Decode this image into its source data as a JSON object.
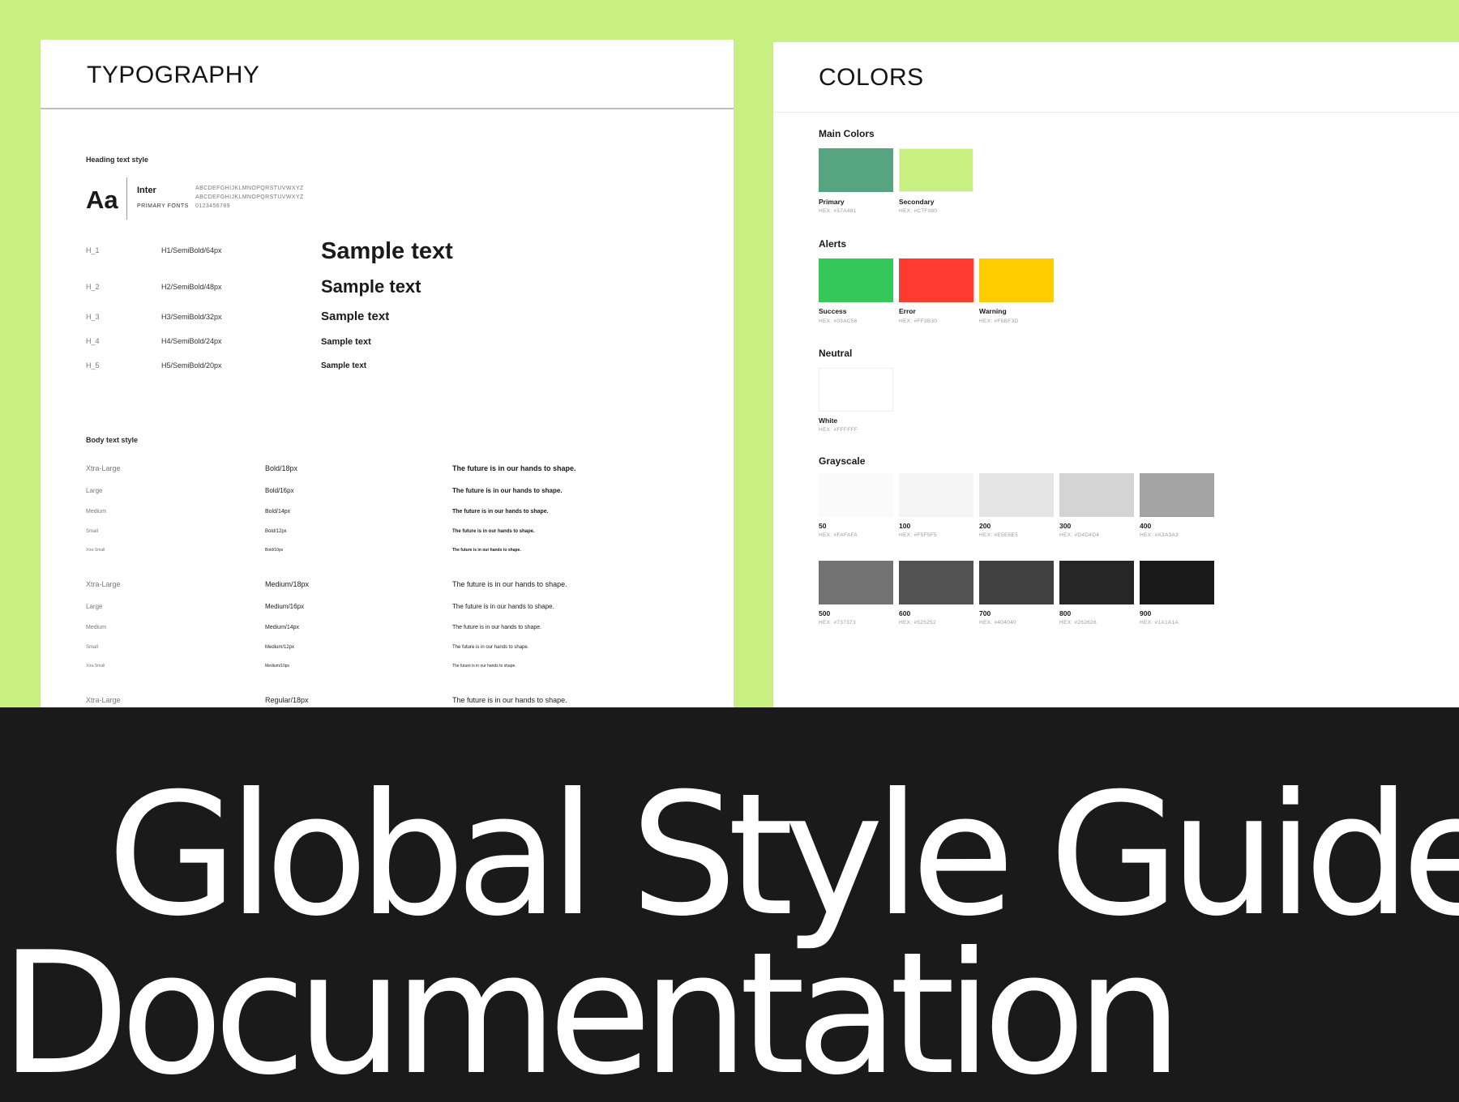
{
  "colors": {
    "page_background": "#C7F080",
    "band_background": "#1A1A1A",
    "panel_background": "#FFFFFF"
  },
  "typography": {
    "title": "TYPOGRAPHY",
    "heading_section_label": "Heading text style",
    "font": {
      "preview": "Aa",
      "name": "Inter",
      "role": "PRIMARY FONTS",
      "uppercase": "ABCDEFGHIJKLMNOPQRSTUVWXYZ",
      "lowercase": "ABCDEFGHIJKLMNOPQRSTUVWXYZ",
      "digits": "0123456789"
    },
    "headings": [
      {
        "code": "H_1",
        "spec": "H1/SemiBold/64px",
        "sample": "Sample text"
      },
      {
        "code": "H_2",
        "spec": "H2/SemiBold/48px",
        "sample": "Sample text"
      },
      {
        "code": "H_3",
        "spec": "H3/SemiBold/32px",
        "sample": "Sample text"
      },
      {
        "code": "H_4",
        "spec": "H4/SemiBold/24px",
        "sample": "Sample text"
      },
      {
        "code": "H_5",
        "spec": "H5/SemiBold/20px",
        "sample": "Sample text"
      }
    ],
    "body_section_label": "Body text style",
    "body_rows": [
      {
        "size": "Xtra-Large",
        "spec": "Bold/18px",
        "sample": "The future is in our hands to shape."
      },
      {
        "size": "Large",
        "spec": "Bold/16px",
        "sample": "The future is in our hands to shape."
      },
      {
        "size": "Medium",
        "spec": "Bold/14px",
        "sample": "The future is in our hands to shape."
      },
      {
        "size": "Small",
        "spec": "Bold/12px",
        "sample": "The future is in our hands to shape."
      },
      {
        "size": "Xtra-Small",
        "spec": "Bold/10px",
        "sample": "The future is in our hands to shape."
      },
      {
        "size": "Xtra-Large",
        "spec": "Medium/18px",
        "sample": "The future is in our hands to shape."
      },
      {
        "size": "Large",
        "spec": "Medium/16px",
        "sample": "The future is in our hands to shape."
      },
      {
        "size": "Medium",
        "spec": "Medium/14px",
        "sample": "The future is in our hands to shape."
      },
      {
        "size": "Small",
        "spec": "Medium/12px",
        "sample": "The future is in our hands to shape."
      },
      {
        "size": "Xtra-Small",
        "spec": "Medium/10px",
        "sample": "The future is in our hands to shape."
      },
      {
        "size": "Xtra-Large",
        "spec": "Regular/18px",
        "sample": "The future is in our hands to shape."
      }
    ]
  },
  "colors_panel": {
    "title": "COLORS",
    "groups": {
      "main": {
        "title": "Main Colors",
        "swatches": [
          {
            "name": "Primary",
            "hex_label": "HEX: #57A481",
            "color": "#57A481"
          },
          {
            "name": "Secondary",
            "hex_label": "HEX: #C7F080",
            "color": "#C7F080"
          }
        ]
      },
      "alerts": {
        "title": "Alerts",
        "swatches": [
          {
            "name": "Success",
            "hex_label": "HEX: #03AC56",
            "color": "#34C759"
          },
          {
            "name": "Error",
            "hex_label": "HEX: #FF3B30",
            "color": "#FF3B30"
          },
          {
            "name": "Warning",
            "hex_label": "HEX: #F5BF3D",
            "color": "#FFCC00"
          }
        ]
      },
      "neutral": {
        "title": "Neutral",
        "swatches": [
          {
            "name": "White",
            "hex_label": "HEX: #FFFFFF",
            "color": "#FFFFFF"
          }
        ]
      },
      "grayscale": {
        "title": "Grayscale",
        "swatches": [
          {
            "name": "50",
            "hex_label": "HEX: #FAFAFA",
            "color": "#FAFAFA"
          },
          {
            "name": "100",
            "hex_label": "HEX: #F5F5F5",
            "color": "#F5F5F5"
          },
          {
            "name": "200",
            "hex_label": "HEX: #E5E5E5",
            "color": "#E5E5E5"
          },
          {
            "name": "300",
            "hex_label": "HEX: #D4D4D4",
            "color": "#D4D4D4"
          },
          {
            "name": "400",
            "hex_label": "HEX: #A3A3A3",
            "color": "#A3A3A3"
          },
          {
            "name": "500",
            "hex_label": "HEX: #737373",
            "color": "#737373"
          },
          {
            "name": "600",
            "hex_label": "HEX: #525252",
            "color": "#525252"
          },
          {
            "name": "700",
            "hex_label": "HEX: #404040",
            "color": "#404040"
          },
          {
            "name": "800",
            "hex_label": "HEX: #262626",
            "color": "#262626"
          },
          {
            "name": "900",
            "hex_label": "HEX: #1A1A1A",
            "color": "#1A1A1A"
          }
        ]
      }
    }
  },
  "headline": {
    "line1": "Global Style Guide",
    "line2": "Documentation"
  }
}
